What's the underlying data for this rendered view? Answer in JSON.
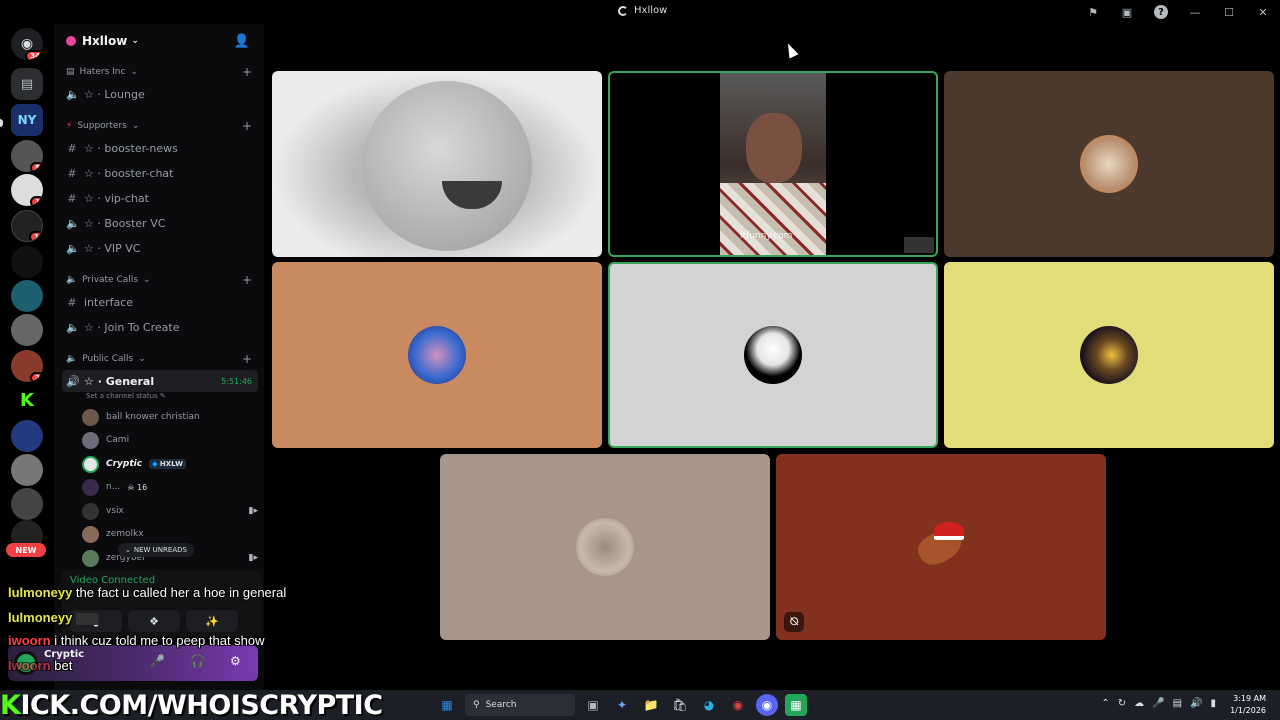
{
  "window": {
    "title": "Hxllow"
  },
  "server": {
    "name": "Hxllow",
    "categories": [
      {
        "label": "Haters Inc",
        "channels": [
          {
            "icon": "speaker",
            "label": "☆ · Lounge"
          }
        ]
      },
      {
        "label": "Supporters",
        "channels": [
          {
            "icon": "hash",
            "label": "☆ · booster-news"
          },
          {
            "icon": "hash",
            "label": "☆ · booster-chat"
          },
          {
            "icon": "hash",
            "label": "☆ · vip-chat"
          },
          {
            "icon": "speaker",
            "label": "☆ · Booster VC"
          },
          {
            "icon": "speaker",
            "label": "☆ · VIP VC"
          }
        ]
      },
      {
        "label": "Private Calls",
        "channels": [
          {
            "icon": "hash",
            "label": "interface"
          },
          {
            "icon": "speaker",
            "label": "☆ · Join To Create"
          }
        ]
      },
      {
        "label": "Public Calls",
        "channels": [
          {
            "icon": "speaker",
            "label": "☆ · General",
            "timer": "5:51:46",
            "status": "Set a channel status"
          }
        ]
      }
    ],
    "voice_users": [
      {
        "name": "ball knower christian"
      },
      {
        "name": "Cami"
      },
      {
        "name": "Cryptic",
        "tag": "HXLW"
      },
      {
        "name": "n...",
        "tag": "16"
      },
      {
        "name": "vsix"
      },
      {
        "name": "zemolkx"
      },
      {
        "name": "zergyber"
      }
    ],
    "new_unreads": "NEW UNREADS"
  },
  "rail": {
    "home_badge": "34",
    "new_label": "NEW",
    "badges": [
      "5",
      "1",
      "1",
      "2"
    ]
  },
  "voice_panel": {
    "status": "Video Connected"
  },
  "user_panel": {
    "name": "Cryptic"
  },
  "chat_overlay": [
    {
      "user": "lulmoneyy",
      "text": "the fact u called her a hoe in general"
    },
    {
      "user": "lulmoneyy",
      "text": ""
    },
    {
      "user": "iwoorn",
      "text": "i think cuz told me to peep that show"
    },
    {
      "user": "Iwoorn",
      "text": "bet"
    }
  ],
  "video_tiles": [
    {
      "kind": "baby-photo",
      "bg": "#e8e8e8"
    },
    {
      "kind": "camera-feed",
      "bg": "#000000",
      "watermark": "itfunny.com",
      "speaking": true
    },
    {
      "kind": "avatar",
      "bg": "#4b3a2c"
    },
    {
      "kind": "avatar",
      "bg": "#c98a62"
    },
    {
      "kind": "avatar",
      "bg": "#d3d3d3",
      "speaking": true
    },
    {
      "kind": "avatar",
      "bg": "#e1dd78"
    },
    {
      "kind": "avatar",
      "bg": "#a8958b"
    },
    {
      "kind": "avatar",
      "bg": "#82311f",
      "muted": true
    }
  ],
  "taskbar": {
    "stream_url": "ICK.COM/WHOISCRYPTIC",
    "stream_url_prefix": "K",
    "search_placeholder": "Search",
    "time": "3:19 AM",
    "date": "1/1/2026"
  },
  "colors": {
    "accent_green": "#23a55a",
    "danger": "#f23f43",
    "kick_green": "#53fc18"
  }
}
